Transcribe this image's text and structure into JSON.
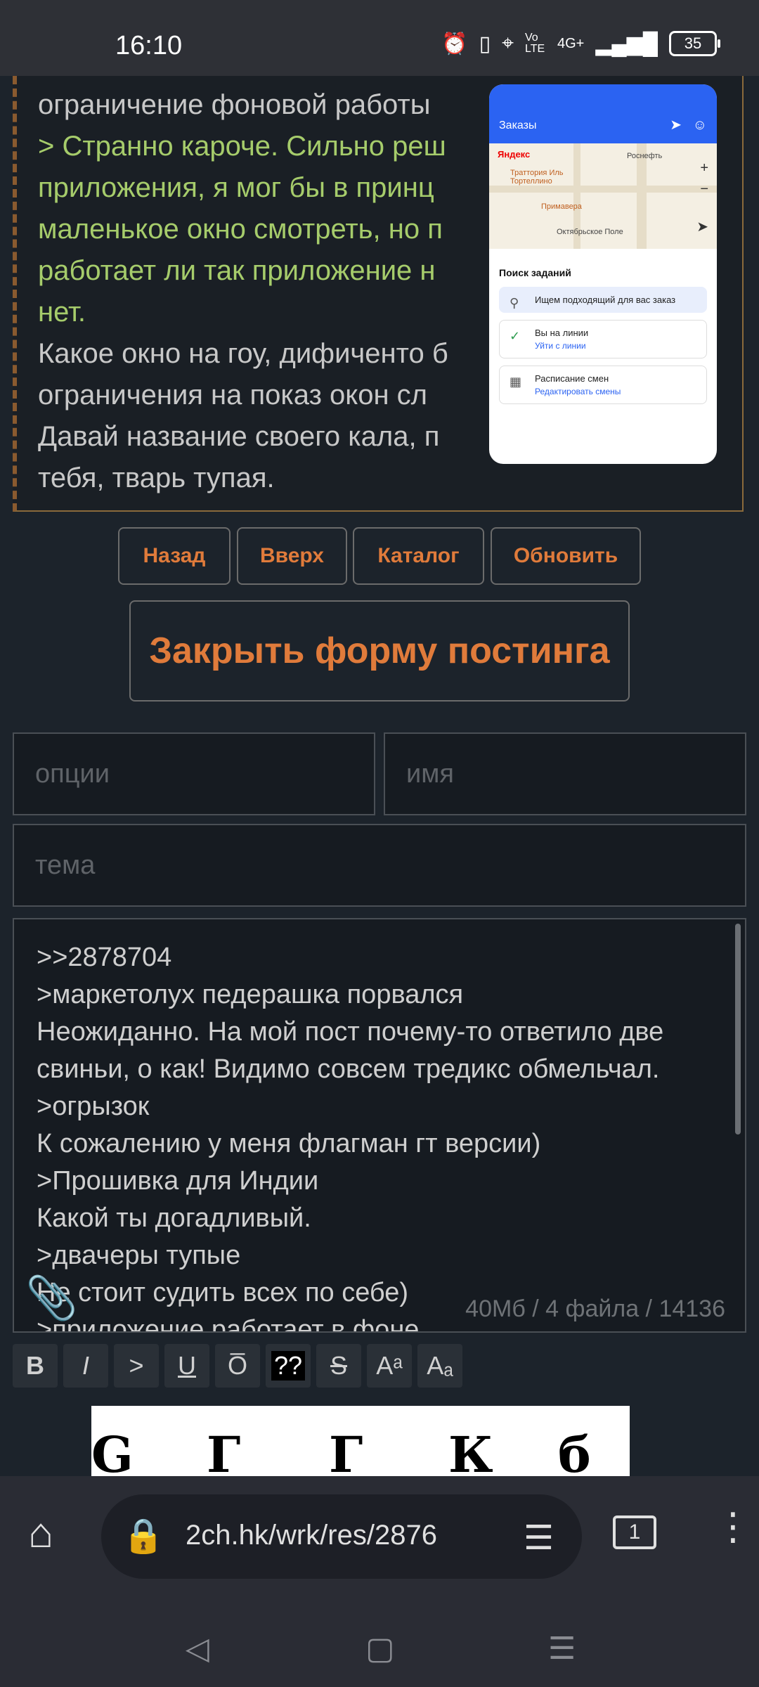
{
  "status": {
    "time": "16:10",
    "battery": "35",
    "network": "4G+",
    "volte": "Vo LTE"
  },
  "post": {
    "lines": [
      {
        "text": "ограничение фоновой работы",
        "quote": false
      },
      {
        "text": "> Странно кароче. Сильно реш",
        "quote": true
      },
      {
        "text": "приложения, я мог бы в принц",
        "quote": true
      },
      {
        "text": "маленькое окно смотреть, но п",
        "quote": true
      },
      {
        "text": "работает ли так приложение н",
        "quote": true
      },
      {
        "text": "нет.",
        "quote": true
      },
      {
        "text": "Какое окно на гоу, дифиченто б",
        "quote": false
      },
      {
        "text": "ограничения на показ окон сл",
        "quote": false
      },
      {
        "text": "Давай название своего кала, п",
        "quote": false
      },
      {
        "text": "тебя, тварь тупая.",
        "quote": false
      }
    ]
  },
  "pip": {
    "header_title": "Заказы",
    "map_brand": "Яндекс",
    "map_labels": [
      "Роснефть",
      "Траттория Иль Тортеллино",
      "Примавера",
      "Октябрьское Поле"
    ],
    "section_title": "Поиск заданий",
    "cards": [
      {
        "title": "Ищем подходящий для вас заказ",
        "sub": ""
      },
      {
        "title": "Вы на линии",
        "sub": "Уйти с линии"
      },
      {
        "title": "Расписание смен",
        "sub": "Редактировать смены"
      }
    ]
  },
  "nav_buttons": {
    "back": "Назад",
    "top": "Вверх",
    "catalog": "Каталог",
    "refresh": "Обновить"
  },
  "close_form": "Закрыть форму постинга",
  "form": {
    "options_placeholder": "опции",
    "name_placeholder": "имя",
    "subject_placeholder": "тема",
    "message_lines": [
      ">>2878704",
      ">маркетолух педерашка порвался",
      "Неожиданно. На мой пост почему-то ответило две",
      "свиньи, о как! Видимо совсем тредикс обмельчал.",
      ">огрызок",
      "К сожалению у меня флагман гт версии)",
      ">Прошивка для Индии",
      "Какой ты догадливый.",
      ">двачеры тупые",
      "Не стоит судить всех по себе)",
      ">приложение работает в фоне"
    ],
    "limits": "40Мб / 4 файла / 14136"
  },
  "format_buttons": [
    "B",
    "I",
    ">",
    "U",
    "O̅",
    "??",
    "S",
    "Aᵃ",
    "Aₐ"
  ],
  "captcha_chars": [
    "G",
    "Г",
    "Г",
    "К",
    "б"
  ],
  "browser": {
    "url": "2ch.hk/wrk/res/2876",
    "tabs": "1"
  }
}
